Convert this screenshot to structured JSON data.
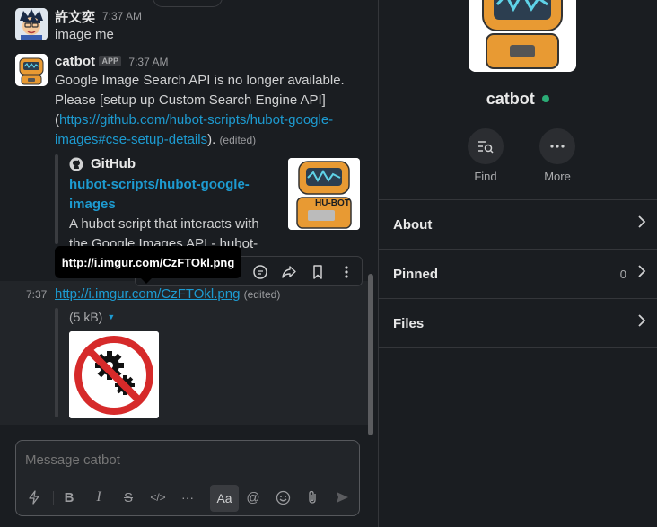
{
  "messages": [
    {
      "author": "許文奕",
      "time": "7:37 AM",
      "text": "image me"
    },
    {
      "author": "catbot",
      "badge": "APP",
      "time": "7:37 AM",
      "line1": "Google Image Search API is no longer available.",
      "line2": "Please [setup up Custom Search Engine API]",
      "paren_open": "(",
      "link1": "https://github.com/hubot-scripts/hubot-google-",
      "link2": "images#cse-setup-details",
      "paren_close": ").",
      "edited": "(edited)",
      "unfurl": {
        "source": "GitHub",
        "title1": "hubot-scripts/hubot-google-",
        "title2": "images",
        "desc1": "A hubot script that interacts with",
        "desc2": "the Google Images API - hubot-",
        "thumb_text": "HU-BOT"
      }
    },
    {
      "time": "7:37",
      "link": "http://i.imgur.com/CzFTOkl.png",
      "edited": "(edited)",
      "file_size": "(5 kB)"
    }
  ],
  "tooltip": "http://i.imgur.com/CzFTOkl.png",
  "composer": {
    "placeholder": "Message catbot",
    "format_label": "Aa"
  },
  "profile": {
    "name": "catbot",
    "status_color": "#2bac76",
    "actions": [
      {
        "label": "Find",
        "icon": "find-icon"
      },
      {
        "label": "More",
        "icon": "more-icon"
      }
    ]
  },
  "sidebar_rows": [
    {
      "label": "About",
      "count": ""
    },
    {
      "label": "Pinned",
      "count": "0"
    },
    {
      "label": "Files",
      "count": ""
    }
  ]
}
